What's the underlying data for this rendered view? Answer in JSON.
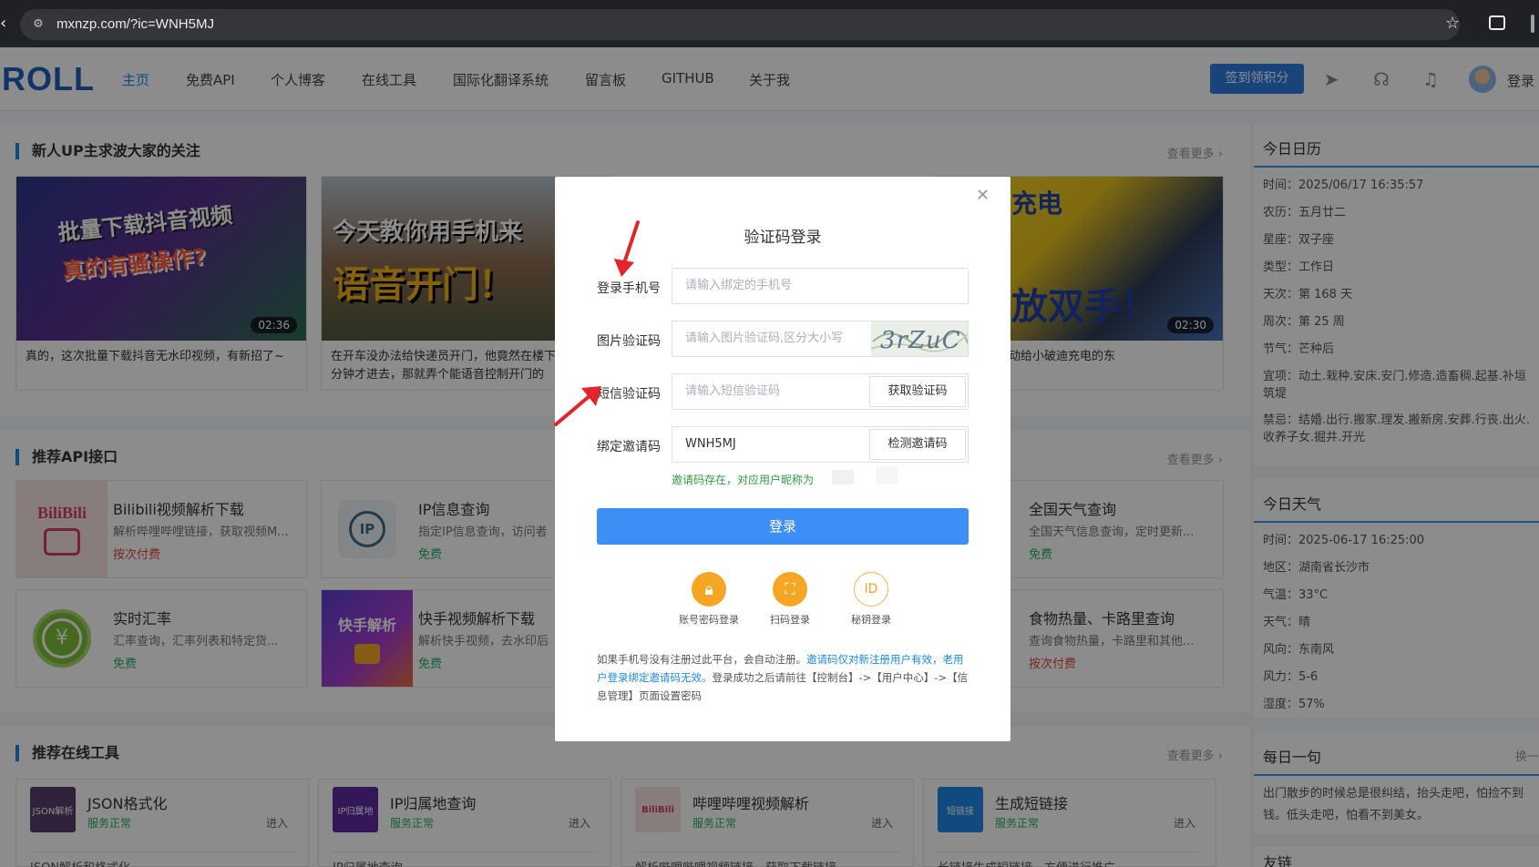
{
  "browser": {
    "url": "mxnzp.com/?ic=WNH5MJ"
  },
  "header": {
    "logo": "ROLL",
    "nav": [
      "主页",
      "免费API",
      "个人博客",
      "在线工具",
      "国际化翻译系统",
      "留言板",
      "GITHUB",
      "关于我"
    ],
    "checkin_label": "签到领积分",
    "login_label": "登录"
  },
  "sections": {
    "new_up": {
      "title": "新人UP主求波大家的关注",
      "more": "查看更多 ›"
    },
    "api": {
      "title": "推荐API接口",
      "more": "查看更多 ›"
    },
    "tools": {
      "title": "推荐在线工具",
      "more": "查看更多 ›"
    }
  },
  "videos": [
    {
      "thumb_line1": "批量下载抖音视频",
      "thumb_line2": "真的有骚操作?",
      "duration": "02:36",
      "title": "真的，这次批量下载抖音无水印视频，有新招了~"
    },
    {
      "thumb_line1": "今天教你用手机来",
      "thumb_line2": "语音开门！",
      "duration": "",
      "title": "在开车没办法给快递员开门，他竟然在楼下等了10分钟才进去，那就弄个能语音控制开门的"
    },
    {
      "thumb_line1": "充电",
      "thumb_line2": "放双手！",
      "duration": "02:30",
      "title": "间自动给小破迪充电的东"
    }
  ],
  "apis": [
    {
      "icon_text": "BiliBili",
      "name": "Bilibili视频解析下载",
      "desc": "解析哔哩哔哩链接，获取视频M...",
      "price": "按次付费"
    },
    {
      "icon_text": "IP",
      "name": "IP信息查询",
      "desc": "指定IP信息查询，访问者",
      "price": "免费"
    },
    {
      "icon_text": "",
      "name": "全国天气查询",
      "desc": "全国天气信息查询，定时更新...",
      "price": "免费"
    },
    {
      "icon_text": "¥",
      "name": "实时汇率",
      "desc": "汇率查询，汇率列表和特定货...",
      "price": "免费"
    },
    {
      "icon_text": "快手解析",
      "name": "快手视频解析下载",
      "desc": "解析快手视频，去水印后",
      "price": "免费"
    },
    {
      "icon_text": "",
      "name": "食物热量、卡路里查询",
      "desc": "查询食物热量，卡路里和其他...",
      "price": "按次付费"
    }
  ],
  "tools": [
    {
      "icon_text": "JSON解析",
      "name": "JSON格式化",
      "status": "服务正常",
      "enter": "进入",
      "desc": "JSON解析和格式化"
    },
    {
      "icon_text": "IP归属地",
      "name": "IP归属地查询",
      "status": "服务正常",
      "enter": "进入",
      "desc": "IP归属地查询"
    },
    {
      "icon_text": "BiliBili",
      "name": "哔哩哔哩视频解析",
      "status": "服务正常",
      "enter": "进入",
      "desc": "解析哔哩哔哩视频链接，获取下载链接"
    },
    {
      "icon_text": "短链接",
      "name": "生成短链接",
      "status": "服务正常",
      "enter": "进入",
      "desc": "长链接生成短链接，方便进行推广"
    }
  ],
  "calendar": {
    "title": "今日日历",
    "rows": [
      "时间：2025/06/17 16:35:57",
      "农历：五月廿二",
      "星座：双子座",
      "类型：工作日",
      "天次：第 168 天",
      "周次：第 25 周",
      "节气：芒种后",
      "宜项：动土.栽种.安床.安门.修造.造畜稠.起基.补垣筑堤",
      "禁忌：结婚.出行.搬家.理发.搬新房.安葬.行丧.出火.收养子女.掘井.开光"
    ]
  },
  "weather": {
    "title": "今日天气",
    "rows": [
      "时间：2025-06-17 16:25:00",
      "地区：湖南省长沙市",
      "气温：33°C",
      "天气：晴",
      "风向：东南风",
      "风力：5-6",
      "湿度：57%"
    ]
  },
  "quote": {
    "title": "每日一句",
    "switch": "换一",
    "text": "出门散步的时候总是很纠结，抬头走吧，怕捡不到钱。低头走吧，怕看不到美女。"
  },
  "links_title": "友链",
  "modal": {
    "title": "验证码登录",
    "phone_label": "登录手机号",
    "phone_placeholder": "请输入绑定的手机号",
    "captcha_label": "图片验证码",
    "captcha_placeholder": "请输入图片验证码,区分大小写",
    "captcha_text": "3rZuC",
    "sms_label": "短信验证码",
    "sms_placeholder": "请输入短信验证码",
    "sms_button": "获取验证码",
    "invite_label": "绑定邀请码",
    "invite_value": "WNH5MJ",
    "invite_button": "检测邀请码",
    "invite_hint": "邀请码存在，对应用户昵称为",
    "login_button": "登录",
    "alt_logins": [
      {
        "icon": "lock-icon",
        "label": "账号密码登录"
      },
      {
        "icon": "scan-icon",
        "label": "扫码登录"
      },
      {
        "icon": "id-icon",
        "label": "秘钥登录"
      }
    ],
    "note_prefix": "如果手机号没有注册过此平台，会自动注册。",
    "note_link": "邀请码仅对新注册用户有效，老用户登录绑定邀请码无效。",
    "note_suffix": "登录成功之后请前往【控制台】->【用户中心】->【信息管理】页面设置密码"
  },
  "colors": {
    "brand": "#1e5fb8",
    "accent": "#3d8ff5",
    "free": "#2bae66",
    "paid": "#e3453a",
    "alt_login": "#f39c12",
    "arrow": "#e6232a"
  }
}
